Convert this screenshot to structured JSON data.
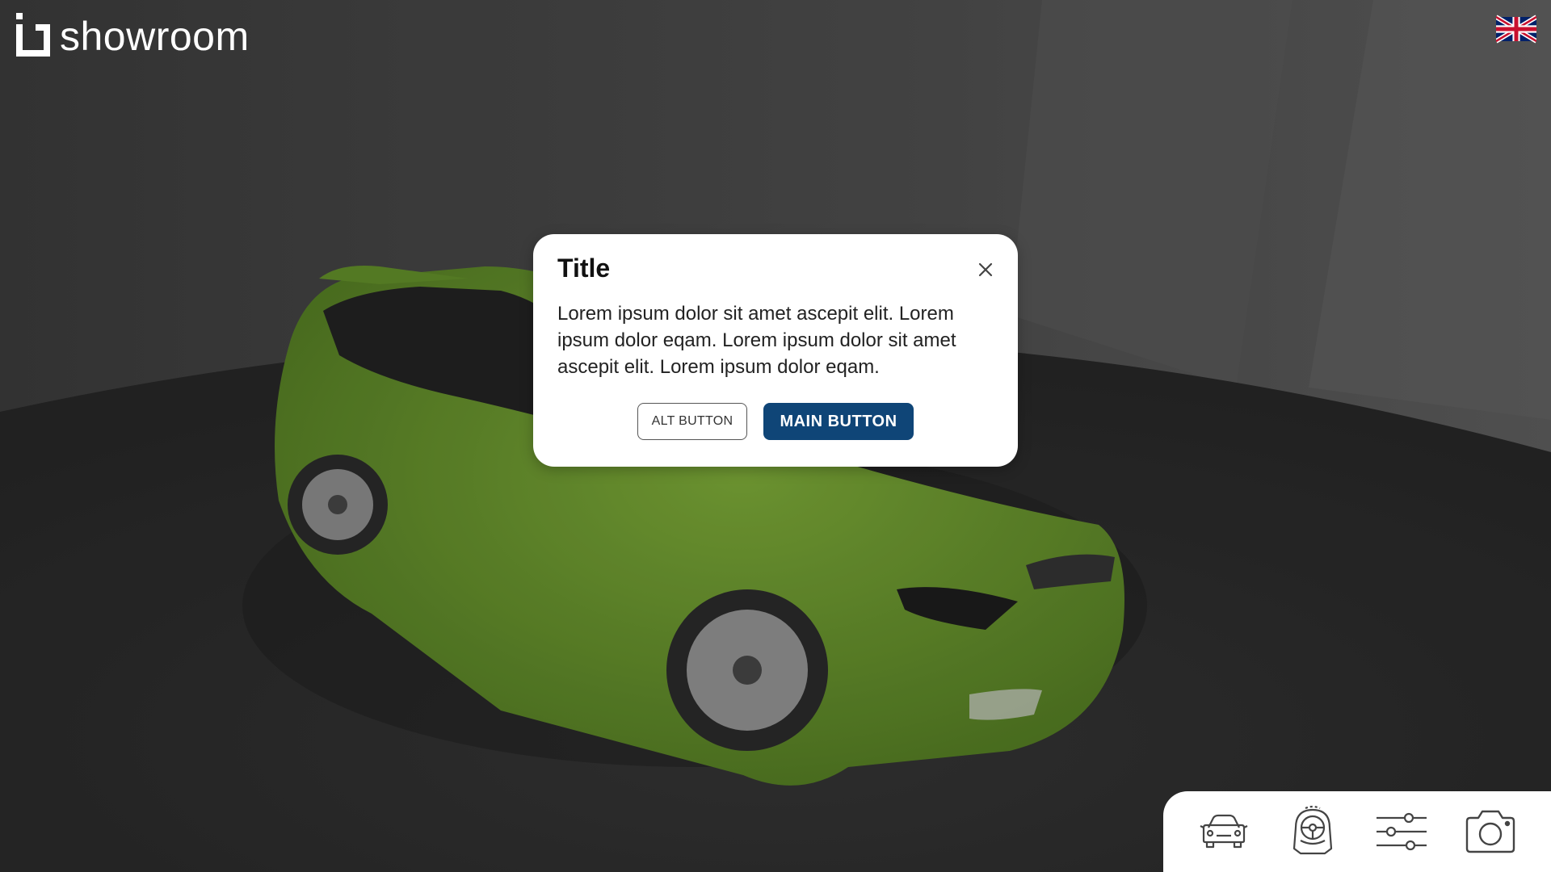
{
  "app": {
    "brand_name": "showroom",
    "language_flag": "uk-flag-icon"
  },
  "dialog": {
    "title": "Title",
    "body": "Lorem ipsum dolor sit amet ascepit elit. Lorem ipsum dolor eqam. Lorem ipsum dolor sit amet ascepit elit. Lorem ipsum dolor eqam.",
    "alt_button": "ALT BUTTON",
    "main_button": "MAIN BUTTON",
    "close_icon": "close-icon"
  },
  "toolbar": {
    "items": [
      {
        "icon": "car-exterior-icon"
      },
      {
        "icon": "car-interior-icon"
      },
      {
        "icon": "configuration-sliders-icon"
      },
      {
        "icon": "camera-icon"
      }
    ]
  },
  "colors": {
    "primary": "#0f4577",
    "car": "#6f9a2e",
    "background": "#2c2c2c"
  }
}
